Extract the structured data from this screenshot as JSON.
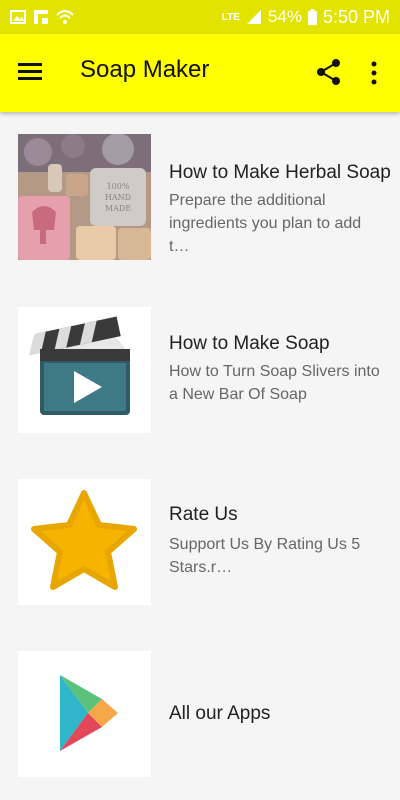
{
  "status_bar": {
    "network": "LTE",
    "battery": "54%",
    "time": "5:50 PM"
  },
  "app_bar": {
    "title": "Soap Maker"
  },
  "items": [
    {
      "title": "How to Make Herbal Soap",
      "subtitle": "Prepare the additional ingredients you plan to add t…",
      "thumb_text": "100% HAND MADE"
    },
    {
      "title": "How to Make Soap",
      "subtitle": "How to Turn Soap Slivers into a New Bar Of Soap"
    },
    {
      "title": "Rate Us",
      "subtitle": "Support Us By Rating Us 5 Stars.r…"
    },
    {
      "title": "All our Apps",
      "subtitle": ""
    }
  ],
  "colors": {
    "app_bar": "#ffff00",
    "status_bar": "#e3e300",
    "star": "#f5b400"
  }
}
